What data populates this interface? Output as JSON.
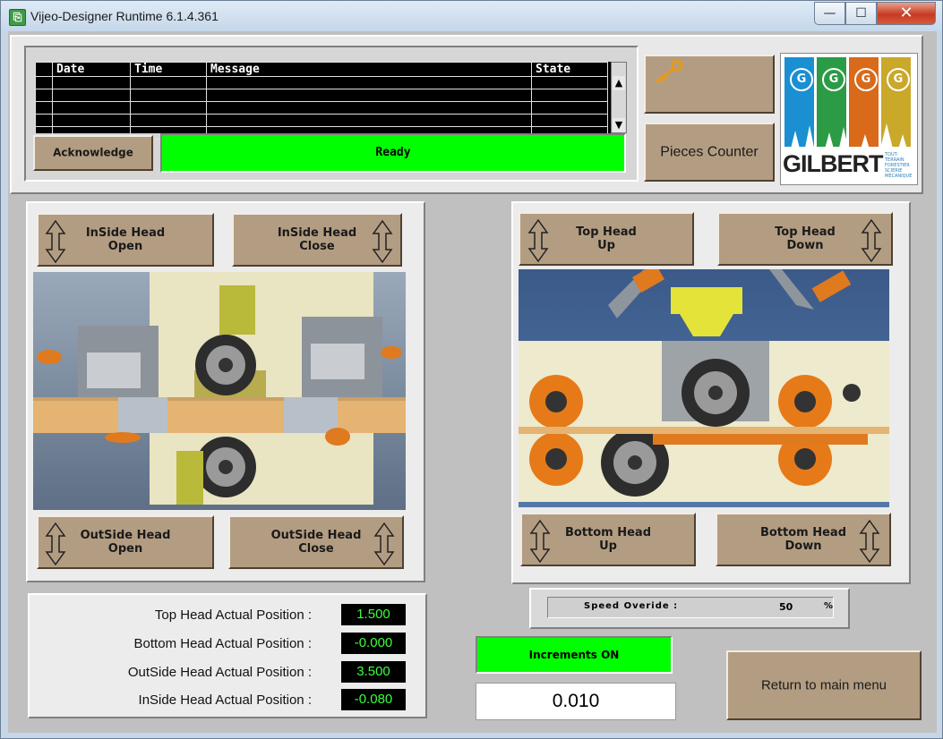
{
  "window": {
    "title": "Vijeo-Designer Runtime 6.1.4.361",
    "min_glyph": "—",
    "max_glyph": "☐",
    "close_glyph": "✕"
  },
  "alarms": {
    "columns": [
      "Date",
      "Time",
      "Message",
      "State"
    ],
    "rows": [
      [
        "",
        "",
        "",
        ""
      ],
      [
        "",
        "",
        "",
        ""
      ],
      [
        "",
        "",
        "",
        ""
      ],
      [
        "",
        "",
        "",
        ""
      ],
      [
        "",
        "",
        "",
        ""
      ]
    ],
    "scroll_up": "▲",
    "scroll_down": "▼"
  },
  "acknowledge_label": "Acknowledge",
  "status_text": "Ready",
  "key_icon": "key-icon",
  "pieces_counter_label": "Pieces Counter",
  "logo": {
    "brand": "GILBERT",
    "tagline": "TOUT-TERRAIN\nFORESTIER\nSCIERIE\nMÉCANIQUE",
    "badge_letter": "G",
    "strip_colors": [
      "#1a8fd1",
      "#2b9b45",
      "#d86a1a",
      "#c9a82a"
    ]
  },
  "inside_head": {
    "open_label": "InSide Head\nOpen",
    "close_label": "InSide Head\nClose"
  },
  "outside_head": {
    "open_label": "OutSide Head\nOpen",
    "close_label": "OutSide Head\nClose"
  },
  "top_head": {
    "up_label": "Top Head\nUp",
    "down_label": "Top Head\nDown"
  },
  "bottom_head": {
    "up_label": "Bottom Head\nUp",
    "down_label": "Bottom Head\nDown"
  },
  "positions": [
    {
      "label": "Top Head Actual Position :",
      "value": "1.500"
    },
    {
      "label": "Bottom Head Actual Position :",
      "value": "-0.000"
    },
    {
      "label": "OutSide Head Actual Position :",
      "value": "3.500"
    },
    {
      "label": "InSide Head Actual Position :",
      "value": "-0.080"
    }
  ],
  "speed_override": {
    "label": "Speed Overide :",
    "value": "50",
    "unit": "%"
  },
  "increments_label": "Increments ON",
  "increment_value": "0.010",
  "return_label": "Return to main menu",
  "colors": {
    "button_brown": "#b39d82",
    "green_status": "#00ff00",
    "readout_text": "#3cff3c"
  }
}
